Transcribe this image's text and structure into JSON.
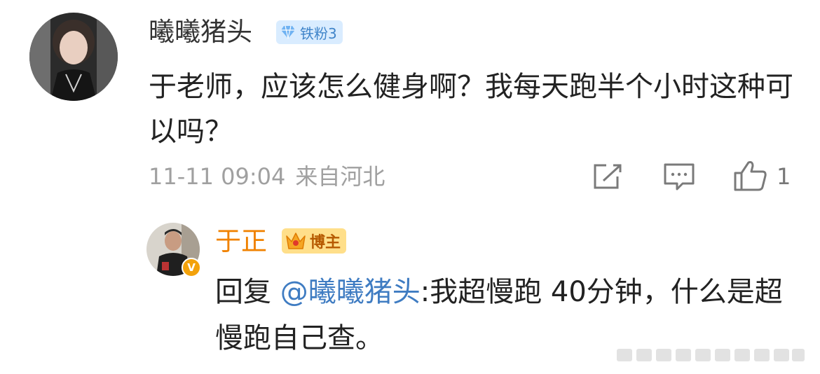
{
  "comment": {
    "username": "曦曦猪头",
    "badge": "铁粉3",
    "text": "于老师，应该怎么健身啊？我每天跑半个小时这种可以吗？",
    "timestamp": "11-11 09:04",
    "location": "来自河北",
    "like_count": "1",
    "icons": [
      "share-icon",
      "comment-icon",
      "like-icon"
    ]
  },
  "reply": {
    "username": "于正",
    "badge": "博主",
    "prefix": "回复 ",
    "mention": "@曦曦猪头",
    "text": ":我超慢跑 40分钟，什么是超慢跑自己查。",
    "verified_icon": "verified-v-icon"
  },
  "colors": {
    "reply_username": "#f08200",
    "mention": "#3f7cc2",
    "meta": "#a0a0a0",
    "fan_badge_bg": "#d9ecff",
    "host_badge_bg": "#ffdf8a"
  }
}
